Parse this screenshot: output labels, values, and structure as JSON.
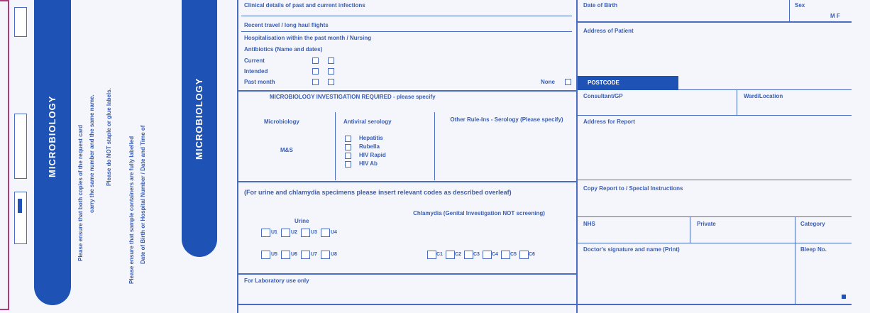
{
  "left_strip": {
    "pill_label": "MICROBIOLOGY",
    "instructions": [
      "Please ensure that both copies of the request card",
      "carry the same number and the same name.",
      "Please do NOT staple or glue labels.",
      "Please ensure that sample containers are fully labelled",
      "Date of Birth or Hospital Number / Date and Time of"
    ]
  },
  "second_strip": {
    "pill_label": "MICROBIOLOGY"
  },
  "form": {
    "clinical_details_label": "Clinical details of past and current infections",
    "recent_travel_label": "Recent travel / long haul flights",
    "hospital_label": "Hospitalisation within the past month / Nursing",
    "antibiotics_label": "Antibiotics (Name and dates)",
    "checklist": [
      "Current",
      "Intended",
      "Past month"
    ],
    "none_label": "None",
    "investigation_heading": "MICROBIOLOGY INVESTIGATION REQUIRED - please specify",
    "col_microbiology": "Microbiology",
    "col_microbiology_value": "M&S",
    "col_antiviral": "Antiviral serology",
    "antiviral_options": [
      "Hepatitis",
      "Rubella",
      "HIV Rapid",
      "HIV Ab"
    ],
    "col_other": "Other Rule-Ins - Serology (Please specify)",
    "urine_note": "(For urine and chlamydia specimens please insert relevant codes as described overleaf)",
    "urine_label": "Urine",
    "urine_codes_row1": [
      "U1",
      "U2",
      "U3",
      "U4"
    ],
    "urine_codes_row2": [
      "U5",
      "U6",
      "U7",
      "U8"
    ],
    "chlamydia_label": "Chlamydia (Genital Investigation NOT screening)",
    "chlamydia_codes": [
      "C1",
      "C2",
      "C3",
      "C4",
      "C5",
      "C6"
    ],
    "lab_use_label": "For Laboratory use only",
    "date_of_birth_label": "Date of Birth",
    "sex_label": "Sex",
    "sex_options": "M F",
    "address_label": "Address of Patient",
    "postcode_label": "POSTCODE",
    "consultant_label": "Consultant/GP",
    "ward_label": "Ward/Location",
    "report_address_label": "Address for Report",
    "copy_report_label": "Copy Report to / Special Instructions",
    "nhs_label": "NHS",
    "private_label": "Private",
    "category_label": "Category",
    "doctor_label": "Doctor's signature and name (Print)",
    "bleep_label": "Bleep No."
  },
  "colors": {
    "ink": "#3a5db3",
    "pill": "#1f52b5",
    "paper": "#f4f6fb",
    "frame": "#b03a7e"
  }
}
